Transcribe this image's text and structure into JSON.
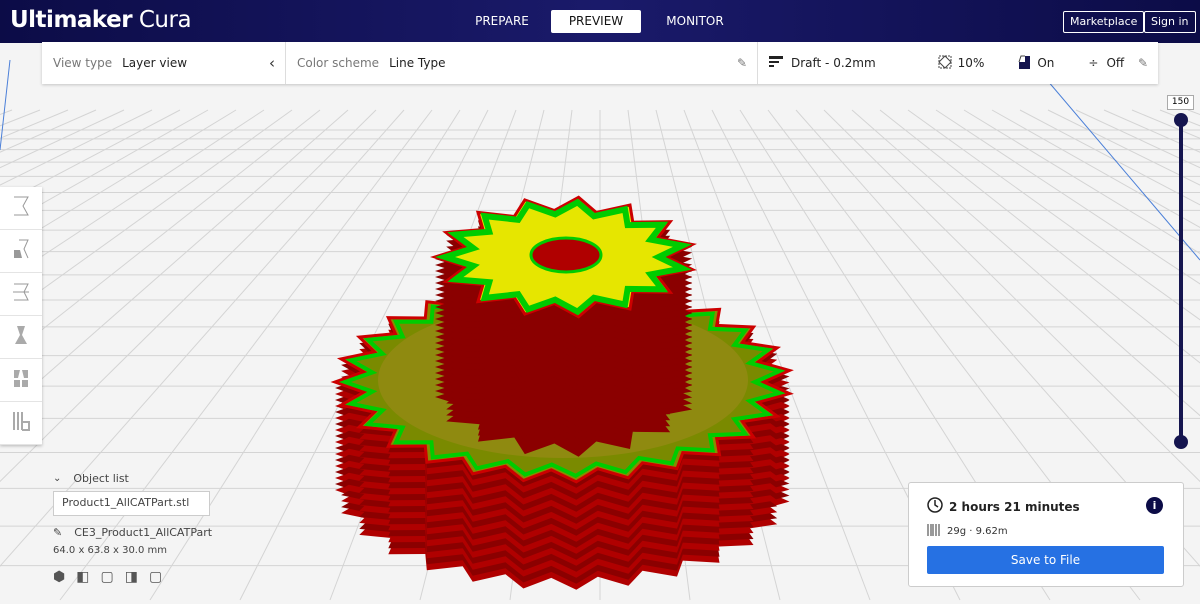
{
  "app": {
    "brand_bold": "Ultimaker",
    "brand_light": "Cura"
  },
  "tabs": [
    {
      "label": "PREPARE"
    },
    {
      "label": "PREVIEW"
    },
    {
      "label": "MONITOR"
    }
  ],
  "header_buttons": {
    "marketplace": "Marketplace",
    "signin": "Sign in"
  },
  "toolbar": {
    "view_type_label": "View type",
    "view_type_value": "Layer view",
    "color_scheme_label": "Color scheme",
    "color_scheme_value": "Line Type",
    "profile": "Draft - 0.2mm",
    "infill": "10%",
    "support": "On",
    "adhesion": "Off"
  },
  "layer_slider": {
    "max_layer": "150",
    "value_fraction": 1.0
  },
  "object_list": {
    "header": "Object list",
    "file": "Product1_AllCATPart.stl",
    "job_name": "CE3_Product1_AllCATPart",
    "dimensions": "64.0 x 63.8 x 30.0 mm"
  },
  "print": {
    "time": "2 hours 21 minutes",
    "material": "29g · 9.62m",
    "save_label": "Save to File"
  },
  "colors": {
    "header": "#0c0c47",
    "accent": "#2671e3",
    "wall_outer": "#cc0000",
    "wall_inner": "#00cc00",
    "infill": "#e6e600"
  }
}
